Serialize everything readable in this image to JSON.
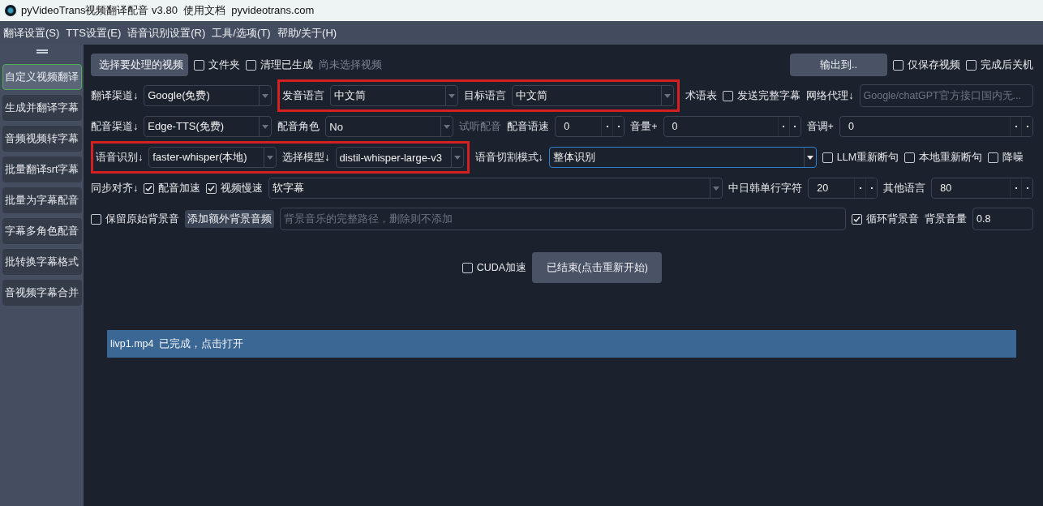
{
  "window": {
    "title": "pyVideoTrans视频翻译配音 v3.80  使用文档  pyvideotrans.com"
  },
  "menu": [
    "翻译设置(S)",
    "TTS设置(E)",
    "语音识别设置(R)",
    "工具/选项(T)",
    "帮助/关于(H)"
  ],
  "sidebar": {
    "items": [
      {
        "label": "自定义视频翻译",
        "selected": true
      },
      {
        "label": "生成并翻译字幕",
        "selected": false
      },
      {
        "label": "音频视频转字幕",
        "selected": false
      },
      {
        "label": "批量翻译srt字幕",
        "selected": false
      },
      {
        "label": "批量为字幕配音",
        "selected": false
      },
      {
        "label": "字幕多角色配音",
        "selected": false
      },
      {
        "label": "批转换字幕格式",
        "selected": false
      },
      {
        "label": "音视频字幕合并",
        "selected": false
      }
    ]
  },
  "rows": [
    [
      {
        "kind": "button",
        "label": "选择要处理的视频"
      },
      {
        "kind": "check",
        "label": "文件夹",
        "checked": false
      },
      {
        "kind": "check",
        "label": "清理已生成",
        "checked": false
      },
      {
        "kind": "hint",
        "text": "尚未选择视频"
      },
      {
        "kind": "button",
        "label": "输出到.."
      },
      {
        "kind": "check",
        "label": "仅保存视频",
        "checked": false
      },
      {
        "kind": "check",
        "label": "完成后关机",
        "checked": false
      }
    ],
    [
      {
        "kind": "label",
        "text": "翻译渠道↓"
      },
      {
        "kind": "combo",
        "value": "Google(免费)",
        "focused": false
      },
      {
        "kind": "highlight",
        "items": [
          {
            "kind": "label",
            "text": "发音语言"
          },
          {
            "kind": "combo",
            "value": "中文简",
            "focused": false
          },
          {
            "kind": "label",
            "text": "目标语言"
          },
          {
            "kind": "combo",
            "value": "中文简",
            "focused": false
          }
        ]
      },
      {
        "kind": "label",
        "text": "术语表"
      },
      {
        "kind": "check",
        "label": "发送完整字幕",
        "checked": false
      },
      {
        "kind": "label",
        "text": "网络代理↓"
      },
      {
        "kind": "input",
        "placeholder": "Google/chatGPT官方接口国内无..."
      }
    ],
    [
      {
        "kind": "label",
        "text": "配音渠道↓"
      },
      {
        "kind": "combo",
        "value": "Edge-TTS(免费)",
        "focused": false
      },
      {
        "kind": "label",
        "text": "配音角色"
      },
      {
        "kind": "combo",
        "value": "No",
        "focused": false
      },
      {
        "kind": "hint",
        "text": "试听配音"
      },
      {
        "kind": "label",
        "text": "配音语速"
      },
      {
        "kind": "spin",
        "value": "0"
      },
      {
        "kind": "label",
        "text": "音量+"
      },
      {
        "kind": "spin",
        "value": "0"
      },
      {
        "kind": "label",
        "text": "音调+"
      },
      {
        "kind": "spin",
        "value": "0"
      }
    ],
    [
      {
        "kind": "highlight",
        "items": [
          {
            "kind": "label",
            "text": "语音识别↓"
          },
          {
            "kind": "combo",
            "value": "faster-whisper(本地)",
            "focused": false
          },
          {
            "kind": "label",
            "text": "选择模型↓"
          },
          {
            "kind": "combo",
            "value": "distil-whisper-large-v3",
            "focused": false
          }
        ]
      },
      {
        "kind": "label",
        "text": "语音切割模式↓"
      },
      {
        "kind": "combo",
        "value": "整体识别",
        "focused": true
      },
      {
        "kind": "check",
        "label": "LLM重新断句",
        "checked": false
      },
      {
        "kind": "check",
        "label": "本地重新断句",
        "checked": false
      },
      {
        "kind": "check",
        "label": "降噪",
        "checked": false
      }
    ],
    [
      {
        "kind": "label",
        "text": "同步对齐↓"
      },
      {
        "kind": "check",
        "label": "配音加速",
        "checked": true
      },
      {
        "kind": "check",
        "label": "视频慢速",
        "checked": true
      },
      {
        "kind": "combo",
        "value": "软字幕",
        "focused": false
      },
      {
        "kind": "label",
        "text": "中日韩单行字符"
      },
      {
        "kind": "spin",
        "value": "20"
      },
      {
        "kind": "label",
        "text": "其他语言"
      },
      {
        "kind": "spin",
        "value": "80"
      }
    ],
    [
      {
        "kind": "check",
        "label": "保留原始背景音",
        "checked": false
      },
      {
        "kind": "small-button",
        "label": "添加额外背景音频"
      },
      {
        "kind": "input",
        "placeholder": "背景音乐的完整路径，删除则不添加"
      },
      {
        "kind": "check",
        "label": "循环背景音",
        "checked": true
      },
      {
        "kind": "label",
        "text": "背景音量"
      },
      {
        "kind": "input",
        "value": "0.8"
      }
    ],
    [
      {
        "kind": "check",
        "label": "CUDA加速",
        "checked": false
      },
      {
        "kind": "button",
        "label": "已结束(点击重新开始)"
      }
    ]
  ],
  "status_bar": "livp1.mp4  已完成，点击打开"
}
